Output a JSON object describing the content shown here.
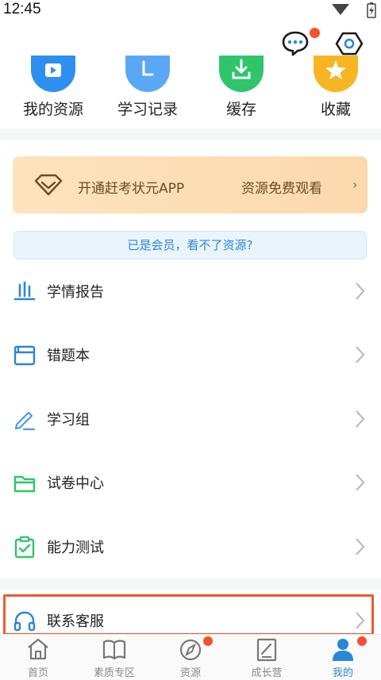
{
  "status": {
    "time": "12:45"
  },
  "header": {
    "chat_icon": "chat-bubble-icon",
    "settings_icon": "hexagon-settings-icon",
    "accent": "#f4512c"
  },
  "quick_actions": [
    {
      "label": "我的资源",
      "icon": "play-icon",
      "color": "#2d8ff0"
    },
    {
      "label": "学习记录",
      "icon": "clock-icon",
      "color": "#5aa8f5"
    },
    {
      "label": "缓存",
      "icon": "download-icon",
      "color": "#2fc56b"
    },
    {
      "label": "收藏",
      "icon": "star-icon",
      "color": "#f7b522"
    }
  ],
  "vip_banner": {
    "text": "开通赶考状元APP",
    "right_text": "资源免费观看",
    "chevron": "›"
  },
  "member_link": "已是会员，看不了资源?",
  "menu": [
    {
      "label": "学情报告",
      "icon": "bar-chart-icon"
    },
    {
      "label": "错题本",
      "icon": "notebook-icon"
    },
    {
      "label": "学习组",
      "icon": "pencil-icon"
    },
    {
      "label": "试卷中心",
      "icon": "folder-icon"
    },
    {
      "label": "能力测试",
      "icon": "clipboard-check-icon"
    },
    {
      "label": "联系客服",
      "icon": "headset-icon"
    }
  ],
  "tabs": [
    {
      "label": "首页",
      "icon": "home-icon"
    },
    {
      "label": "素质专区",
      "icon": "book-icon"
    },
    {
      "label": "资源",
      "icon": "compass-icon"
    },
    {
      "label": "成长营",
      "icon": "edit-note-icon"
    },
    {
      "label": "我的",
      "icon": "user-icon",
      "active": true
    }
  ],
  "colors": {
    "primary": "#2a86d6",
    "badge": "#f4512c",
    "highlight": "#ef5a2f"
  }
}
